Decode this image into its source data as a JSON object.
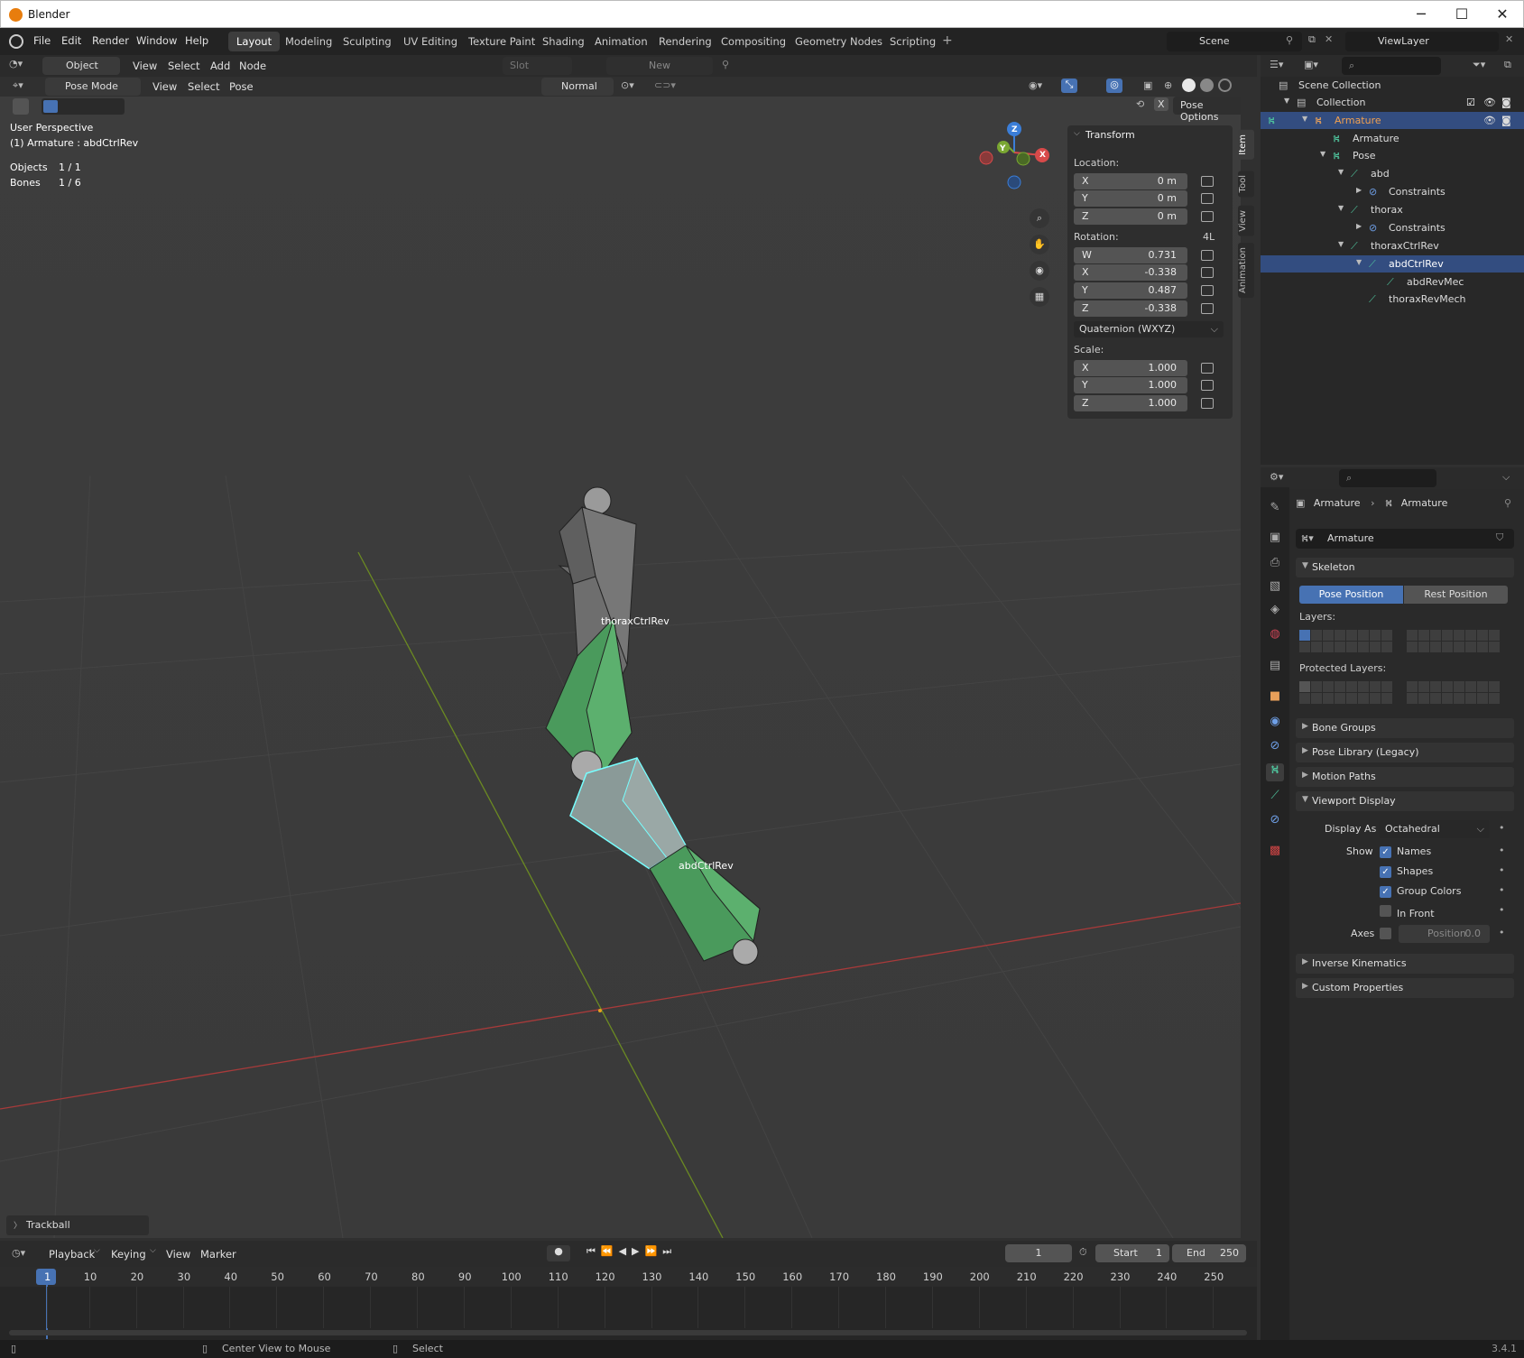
{
  "window": {
    "title": "Blender",
    "minimize": "─",
    "maximize": "☐",
    "close": "✕"
  },
  "menu": [
    "File",
    "Edit",
    "Render",
    "Window",
    "Help"
  ],
  "workspaces": [
    "Layout",
    "Modeling",
    "Sculpting",
    "UV Editing",
    "Texture Paint",
    "Shading",
    "Animation",
    "Rendering",
    "Compositing",
    "Geometry Nodes",
    "Scripting"
  ],
  "scene": "Scene",
  "view_layer": "ViewLayer",
  "editor_header": {
    "mode": "Object",
    "view": "View",
    "select": "Select",
    "add": "Add",
    "node": "Node",
    "slot": "Slot",
    "new": "New"
  },
  "viewport_header": {
    "mode": "Pose Mode",
    "view": "View",
    "select": "Select",
    "pose": "Pose",
    "orientation": "Normal",
    "pose_options": "Pose Options"
  },
  "overlay_text": {
    "perspective": "User Perspective",
    "active": "(1) Armature : abdCtrlRev",
    "objects_label": "Objects",
    "objects_value": "1 / 1",
    "bones_label": "Bones",
    "bones_value": "1 / 6"
  },
  "bone_labels": {
    "upper": "thoraxCtrlRev",
    "lower": "abdCtrlRev"
  },
  "trackball": "Trackball",
  "gizmo": {
    "z": "Z",
    "y": "Y",
    "x": "X"
  },
  "transform": {
    "title": "Transform",
    "location_label": "Location:",
    "location": [
      {
        "axis": "X",
        "value": "0 m"
      },
      {
        "axis": "Y",
        "value": "0 m"
      },
      {
        "axis": "Z",
        "value": "0 m"
      }
    ],
    "rotation_label": "Rotation:",
    "rotation_mode_short": "4L",
    "rotation": [
      {
        "axis": "W",
        "value": "0.731"
      },
      {
        "axis": "X",
        "value": "-0.338"
      },
      {
        "axis": "Y",
        "value": "0.487"
      },
      {
        "axis": "Z",
        "value": "-0.338"
      }
    ],
    "rotation_mode": "Quaternion (WXYZ)",
    "scale_label": "Scale:",
    "scale": [
      {
        "axis": "X",
        "value": "1.000"
      },
      {
        "axis": "Y",
        "value": "1.000"
      },
      {
        "axis": "Z",
        "value": "1.000"
      }
    ]
  },
  "side_tabs": [
    "Item",
    "Tool",
    "View",
    "Animation"
  ],
  "outliner": [
    {
      "label": "Scene Collection"
    },
    {
      "label": "Collection"
    },
    {
      "label": "Armature"
    },
    {
      "label": "Armature"
    },
    {
      "label": "Pose"
    },
    {
      "label": "abd"
    },
    {
      "label": "Constraints"
    },
    {
      "label": "thorax"
    },
    {
      "label": "Constraints"
    },
    {
      "label": "thoraxCtrlRev"
    },
    {
      "label": "abdCtrlRev"
    },
    {
      "label": "abdRevMec"
    },
    {
      "label": "thoraxRevMech"
    }
  ],
  "properties": {
    "breadcrumb_obj": "Armature",
    "breadcrumb_data": "Armature",
    "data_name": "Armature",
    "skeleton": "Skeleton",
    "pose_position": "Pose Position",
    "rest_position": "Rest Position",
    "layers": "Layers:",
    "protected_layers": "Protected Layers:",
    "bone_groups": "Bone Groups",
    "pose_library": "Pose Library (Legacy)",
    "motion_paths": "Motion Paths",
    "viewport_display": "Viewport Display",
    "display_as_label": "Display As",
    "display_as": "Octahedral",
    "show_label": "Show",
    "names": "Names",
    "shapes": "Shapes",
    "group_colors": "Group Colors",
    "in_front": "In Front",
    "axes_label": "Axes",
    "position_label": "Position",
    "position_value": "0.0",
    "inverse_kinematics": "Inverse Kinematics",
    "custom_properties": "Custom Properties"
  },
  "timeline": {
    "playback": "Playback",
    "keying": "Keying",
    "view": "View",
    "marker": "Marker",
    "current_frame": "1",
    "start_label": "Start",
    "start": "1",
    "end_label": "End",
    "end": "250",
    "ticks": [
      "1",
      "10",
      "20",
      "30",
      "40",
      "50",
      "60",
      "70",
      "80",
      "90",
      "100",
      "110",
      "120",
      "130",
      "140",
      "150",
      "160",
      "170",
      "180",
      "190",
      "200",
      "210",
      "220",
      "230",
      "240",
      "250"
    ]
  },
  "status": {
    "left": "Center View to Mouse",
    "right": "Select",
    "version": "3.4.1"
  }
}
